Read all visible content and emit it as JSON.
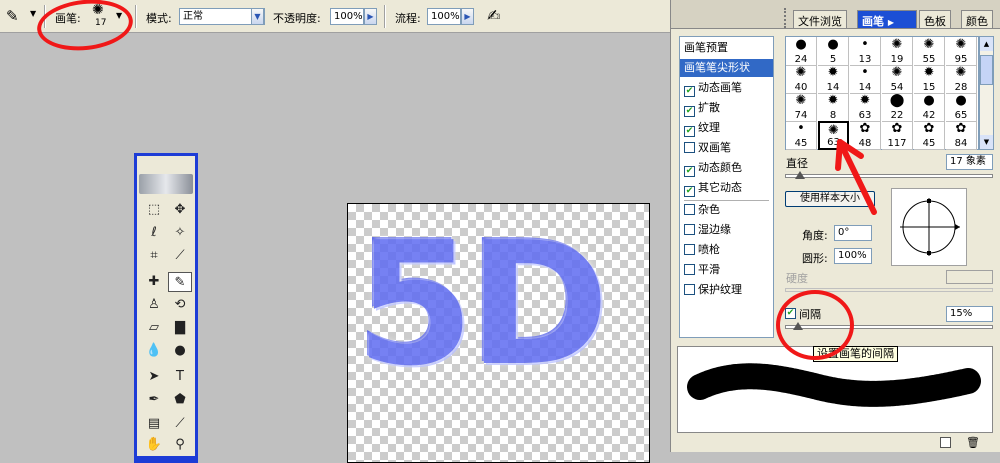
{
  "options_bar": {
    "brush_label": "画笔:",
    "brush_size": "17",
    "mode_label": "模式:",
    "mode_value": "正常",
    "opacity_label": "不透明度:",
    "opacity_value": "100%",
    "flow_label": "流程:",
    "flow_value": "100%"
  },
  "panel": {
    "tabs": [
      "文件浏览",
      "画笔",
      "色板",
      "颜色"
    ],
    "active_tab": "画笔",
    "brush_options": [
      {
        "label": "画笔预置",
        "checkbox": false
      },
      {
        "label": "画笔笔尖形状",
        "checkbox": false,
        "highlight": true
      },
      {
        "label": "动态画笔",
        "checkbox": true,
        "checked": true
      },
      {
        "label": "扩散",
        "checkbox": true,
        "checked": true
      },
      {
        "label": "纹理",
        "checkbox": true,
        "checked": true
      },
      {
        "label": "双画笔",
        "checkbox": true,
        "checked": false
      },
      {
        "label": "动态颜色",
        "checkbox": true,
        "checked": true
      },
      {
        "label": "其它动态",
        "checkbox": true,
        "checked": true
      },
      {
        "label": "杂色",
        "checkbox": true,
        "checked": false
      },
      {
        "label": "湿边缘",
        "checkbox": true,
        "checked": false
      },
      {
        "label": "喷枪",
        "checkbox": true,
        "checked": false
      },
      {
        "label": "平滑",
        "checkbox": true,
        "checked": false
      },
      {
        "label": "保护纹理",
        "checkbox": true,
        "checked": false
      }
    ],
    "brush_tips": [
      {
        "size": "24"
      },
      {
        "size": "5"
      },
      {
        "size": "13"
      },
      {
        "size": "19"
      },
      {
        "size": "55"
      },
      {
        "size": "95"
      },
      {
        "size": "40"
      },
      {
        "size": "14"
      },
      {
        "size": "14"
      },
      {
        "size": "54"
      },
      {
        "size": "15"
      },
      {
        "size": "28"
      },
      {
        "size": "74"
      },
      {
        "size": "8"
      },
      {
        "size": "63"
      },
      {
        "size": "22"
      },
      {
        "size": "42"
      },
      {
        "size": "65"
      },
      {
        "size": "45"
      },
      {
        "size": "63",
        "selected": true
      },
      {
        "size": "48"
      },
      {
        "size": "117"
      },
      {
        "size": "45"
      },
      {
        "size": "84"
      }
    ],
    "diameter_label": "直径",
    "diameter_value": "17 象素",
    "use_sample_button": "使用样本大小",
    "angle_label": "角度:",
    "angle_value": "0°",
    "roundness_label": "圆形:",
    "roundness_value": "100%",
    "hardness_label": "硬度",
    "spacing_label": "间隔",
    "spacing_checked": true,
    "spacing_value": "15%",
    "tooltip": "设置画笔的间隔"
  },
  "canvas": {
    "text": "5D"
  }
}
